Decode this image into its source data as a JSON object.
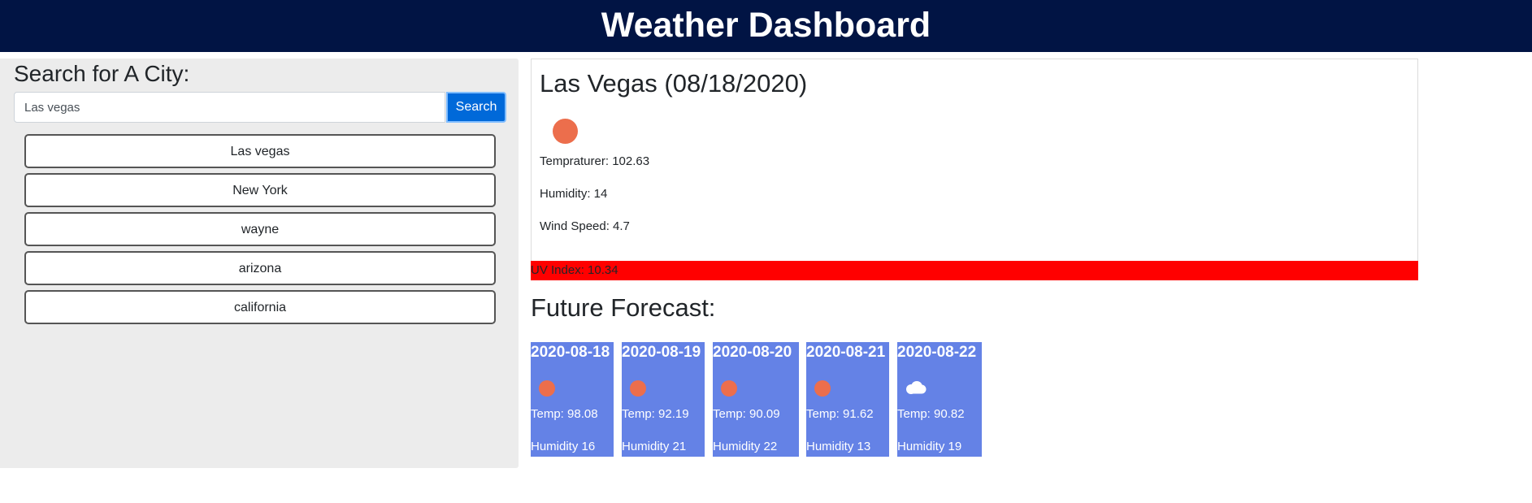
{
  "header": {
    "title": "Weather Dashboard"
  },
  "search": {
    "heading": "Search for A City:",
    "input_value": "Las vegas",
    "button_label": "Search",
    "history": [
      "Las vegas",
      "New York",
      "wayne",
      "arizona",
      "california"
    ]
  },
  "current": {
    "title": "Las Vegas (08/18/2020)",
    "icon": "sun-icon",
    "temperature": "Tempraturer: 102.63",
    "humidity": "Humidity: 14",
    "wind": "Wind Speed: 4.7",
    "uv": "UV Index: 10.34",
    "uv_color": "#ff0000"
  },
  "forecast": {
    "title": "Future Forecast:",
    "card_color": "#6482e6",
    "days": [
      {
        "date": "2020-08-18",
        "icon": "sun-icon",
        "temp": "Temp: 98.08",
        "humidity": "Humidity 16"
      },
      {
        "date": "2020-08-19",
        "icon": "sun-icon",
        "temp": "Temp: 92.19",
        "humidity": "Humidity 21"
      },
      {
        "date": "2020-08-20",
        "icon": "sun-icon",
        "temp": "Temp: 90.09",
        "humidity": "Humidity 22"
      },
      {
        "date": "2020-08-21",
        "icon": "sun-icon",
        "temp": "Temp: 91.62",
        "humidity": "Humidity 13"
      },
      {
        "date": "2020-08-22",
        "icon": "cloud-icon",
        "temp": "Temp: 90.82",
        "humidity": "Humidity 19"
      }
    ]
  }
}
